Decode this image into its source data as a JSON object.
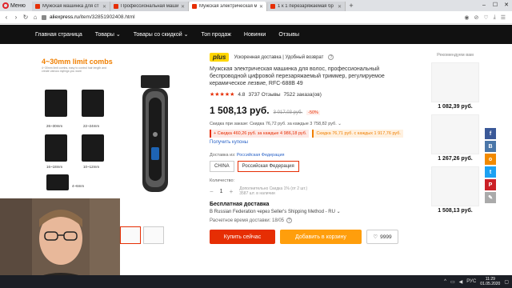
{
  "browser": {
    "menu_label": "Меню",
    "tabs": [
      {
        "title": "Мужская машинка для ст",
        "active": false
      },
      {
        "title": "Профессиональная маши",
        "active": false
      },
      {
        "title": "Мужская электрическая м",
        "active": true
      },
      {
        "title": "1 к 1 перезаряжаемая бр",
        "active": false
      }
    ],
    "url_host": "aliexpress.ru",
    "url_path": "/item/32851902408.html"
  },
  "nav": {
    "items": [
      "Главная страница",
      "Товары",
      "Товары со скидкой",
      "Топ продаж",
      "Новинки",
      "Отзывы"
    ]
  },
  "gallery": {
    "combs_title": "4~30mm limit combs",
    "combs_sub": "4~30mm limit combs, easy to control hair length and create various stylings you want",
    "labels": [
      "26~30mm",
      "22~24mm",
      "16~18mm",
      "10~12mm",
      "4~6mm",
      "",
      "",
      ""
    ]
  },
  "product": {
    "plus_badge": "plus",
    "plus_text": "Ускоренная доставка | Удобный возврат",
    "title": "Мужская электрическая машинка для волос, профессиональный беспроводной цифровой перезаряжаемый триммер, регулируемое керамическое лезвие, RFC-688B 49",
    "rating": "4.8",
    "reviews": "3737 Отзывы",
    "orders": "7522 заказа(ов)",
    "price": "1 508,13 руб.",
    "old_price": "3 017,03 руб.",
    "discount": "-50%",
    "order_discount": "Скидка при заказе: Скидка 76,72 руб. за каждые 3 758,82 руб.",
    "coupon1": "+ Скидка 460,26 руб. за каждые 4 986,18 руб.",
    "coupon2": "Скидка 76,71 руб. с каждых 1 917,76 руб.",
    "get_coupons": "Получить купоны",
    "ship_from_label": "Доставка из:",
    "ship_from_value": "Российская Федерация",
    "options": [
      "CHINA",
      "Российская Федерация"
    ],
    "qty_label": "Количество:",
    "qty_value": "1",
    "qty_note_1": "Дополнительно Скидка 1% (от 2 шт.)",
    "qty_note_2": "3587 шт. в наличии",
    "free_shipping": "Бесплатная доставка",
    "shipping_line": "В Russian Federation через Seller's Shipping Method - RU",
    "eta": "Расчетное время доставки: 18/05",
    "buy_now": "Купить сейчас",
    "add_to_cart": "Добавить в корзину",
    "wishlist_count": "9999"
  },
  "recommended": {
    "title": "Рекомендуем вам",
    "prices": [
      "1 082,39 руб.",
      "1 267,26 руб.",
      "1 508,13 руб."
    ]
  },
  "social": [
    "f",
    "vk",
    "ok",
    "tw",
    "p"
  ],
  "taskbar": {
    "time": "11:29",
    "date": "01.05.2020"
  }
}
